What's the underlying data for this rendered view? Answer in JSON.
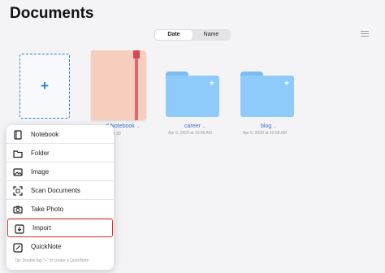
{
  "header": {
    "title": "Documents"
  },
  "sort": {
    "options": [
      "Date",
      "Name"
    ],
    "selected": "Date"
  },
  "items": [
    {
      "title": "d Notebook",
      "date": "r 30"
    },
    {
      "title": "career",
      "date": "Apr 6, 2020 at 10:09 AM"
    },
    {
      "title": "blog",
      "date": "Apr 6, 2020 at 10:08 AM"
    }
  ],
  "menu": {
    "items": [
      {
        "label": "Notebook",
        "icon": "notebook-icon"
      },
      {
        "label": "Folder",
        "icon": "folder-icon"
      },
      {
        "label": "Image",
        "icon": "image-icon"
      },
      {
        "label": "Scan Documents",
        "icon": "scan-icon"
      },
      {
        "label": "Take Photo",
        "icon": "camera-icon"
      },
      {
        "label": "Import",
        "icon": "import-icon"
      },
      {
        "label": "QuickNote",
        "icon": "quicknote-icon"
      }
    ],
    "tip": "Tip: Double tap \"+\" to create a QuickNote"
  },
  "colors": {
    "accent": "#2f7fd6",
    "folder": "#8ecbfa",
    "highlight": "#e02a2a",
    "notebook": "#f7cdbd"
  }
}
